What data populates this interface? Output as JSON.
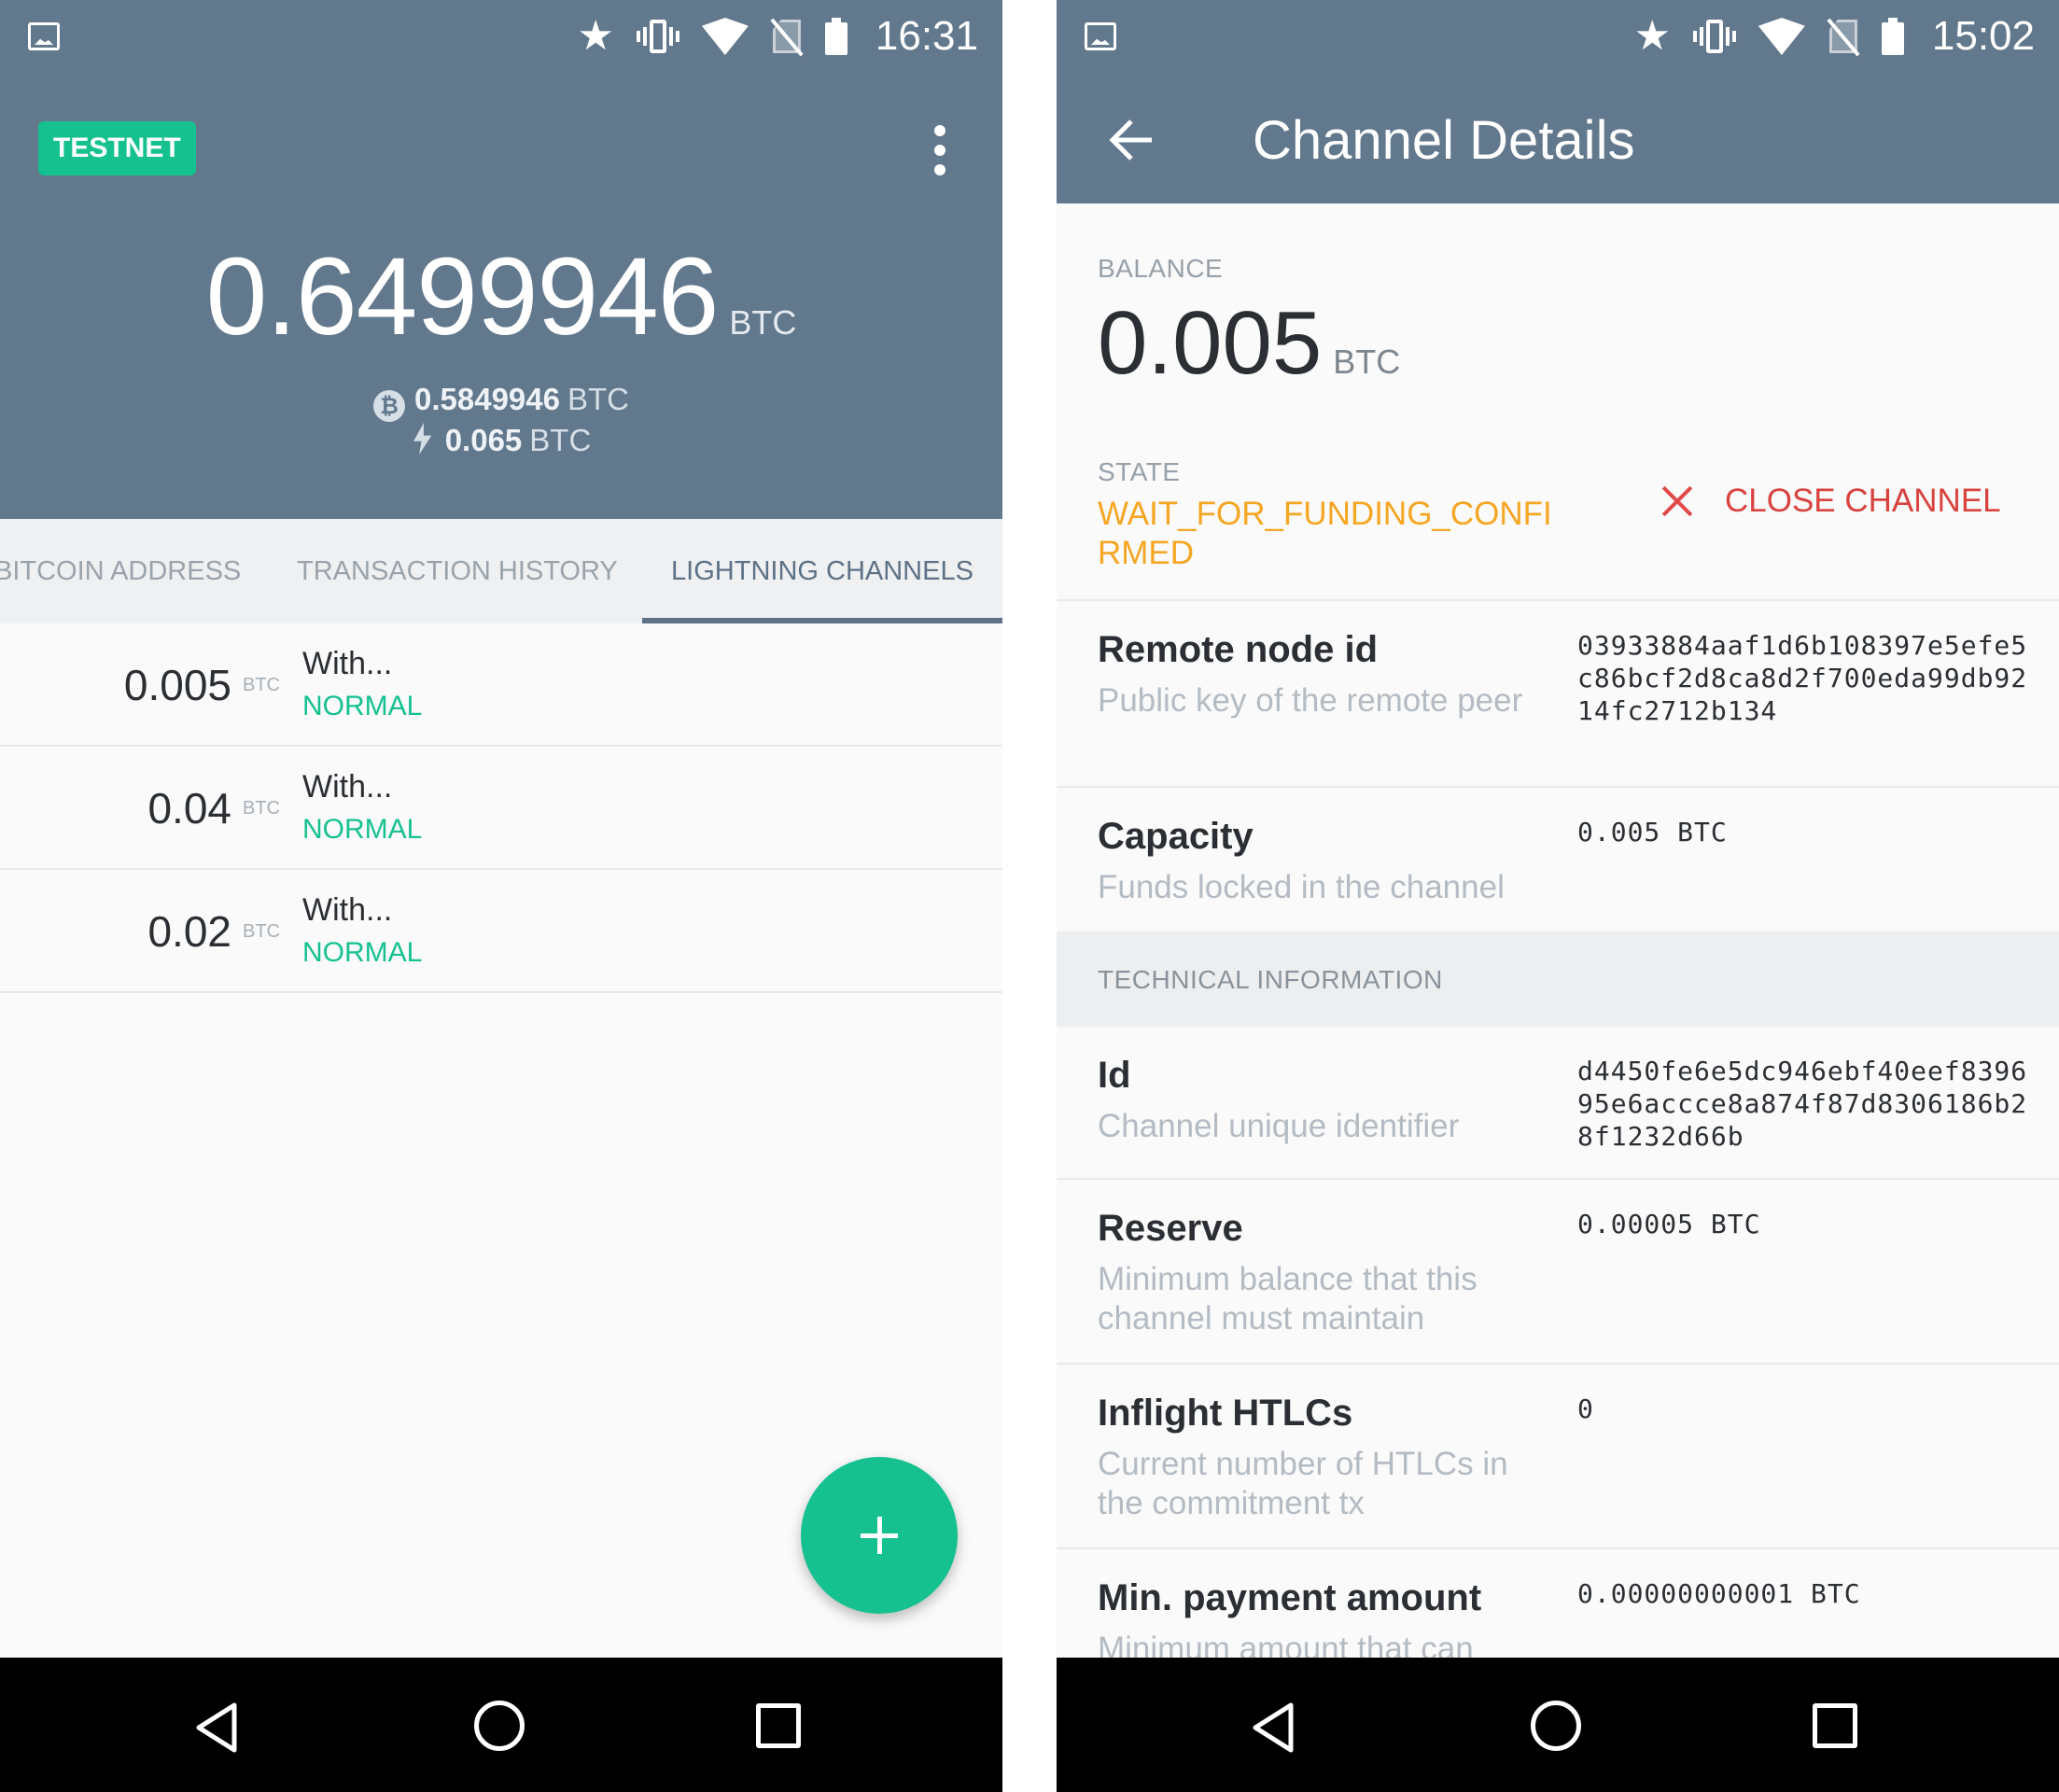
{
  "left": {
    "status": {
      "time": "16:31"
    },
    "header": {
      "network_badge": "TESTNET",
      "total_amount": "0.6499946",
      "total_unit": "BTC",
      "onchain_amount": "0.5849946",
      "onchain_unit": "BTC",
      "lightning_amount": "0.065",
      "lightning_unit": "BTC"
    },
    "tabs": [
      {
        "label": "BITCOIN ADDRESS"
      },
      {
        "label": "TRANSACTION HISTORY"
      },
      {
        "label": "LIGHTNING CHANNELS"
      }
    ],
    "channels": [
      {
        "amount": "0.005",
        "unit": "BTC",
        "name": "With...",
        "state": "NORMAL"
      },
      {
        "amount": "0.04",
        "unit": "BTC",
        "name": "With...",
        "state": "NORMAL"
      },
      {
        "amount": "0.02",
        "unit": "BTC",
        "name": "With...",
        "state": "NORMAL"
      }
    ]
  },
  "right": {
    "status": {
      "time": "15:02"
    },
    "app_bar": {
      "title": "Channel Details"
    },
    "balance": {
      "label": "BALANCE",
      "amount": "0.005",
      "unit": "BTC"
    },
    "state": {
      "label": "STATE",
      "value": "WAIT_FOR_FUNDING_CONFIRMED"
    },
    "close_button": {
      "label": "CLOSE CHANNEL"
    },
    "details": {
      "remote_node": {
        "title": "Remote node id",
        "desc": "Public key of the remote peer",
        "value": "03933884aaf1d6b108397e5efe5c86bcf2d8ca8d2f700eda99db9214fc2712b134"
      },
      "capacity": {
        "title": "Capacity",
        "desc": "Funds locked in the channel",
        "value": "0.005 BTC"
      },
      "tech_header": "TECHNICAL INFORMATION",
      "id": {
        "title": "Id",
        "desc": "Channel unique identifier",
        "value": "d4450fe6e5dc946ebf40eef839695e6accce8a874f87d8306186b28f1232d66b"
      },
      "reserve": {
        "title": "Reserve",
        "desc": "Minimum balance that this channel must maintain",
        "value": "0.00005 BTC"
      },
      "inflight": {
        "title": "Inflight HTLCs",
        "desc": "Current number of HTLCs in the commitment tx",
        "value": "0"
      },
      "min_payment": {
        "title": "Min. payment amount",
        "desc": "Minimum amount that can",
        "value": "0.00000000001 BTC"
      }
    }
  },
  "colors": {
    "header": "#62788d",
    "accent_green": "#16c190",
    "state_orange": "#f5a623",
    "close_red": "#d8433f"
  }
}
